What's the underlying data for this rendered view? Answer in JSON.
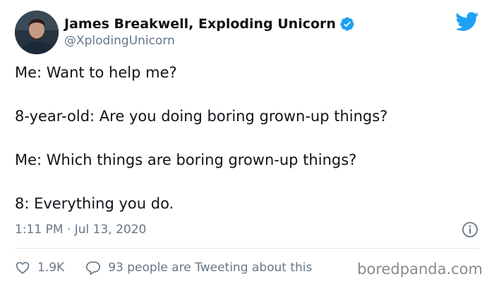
{
  "author": {
    "display_name": "James Breakwell, Exploding Unicorn",
    "handle": "@XplodingUnicorn",
    "verified": true,
    "avatar_icon": "profile-photo"
  },
  "brand": {
    "logo_icon": "twitter-bird-icon",
    "color": "#1da1f2"
  },
  "tweet": {
    "lines": [
      "Me: Want to help me?",
      "8-year-old: Are you doing boring grown-up things?",
      "Me: Which things are boring grown-up things?",
      "8: Everything you do."
    ],
    "timestamp": "1:11 PM · Jul 13, 2020"
  },
  "stats": {
    "likes": "1.9K",
    "conversation_text": "93 people are Tweeting about this"
  },
  "watermark": "boredpanda.com",
  "colors": {
    "text": "#0f1419",
    "secondary": "#657786",
    "verified": "#1da1f2"
  }
}
